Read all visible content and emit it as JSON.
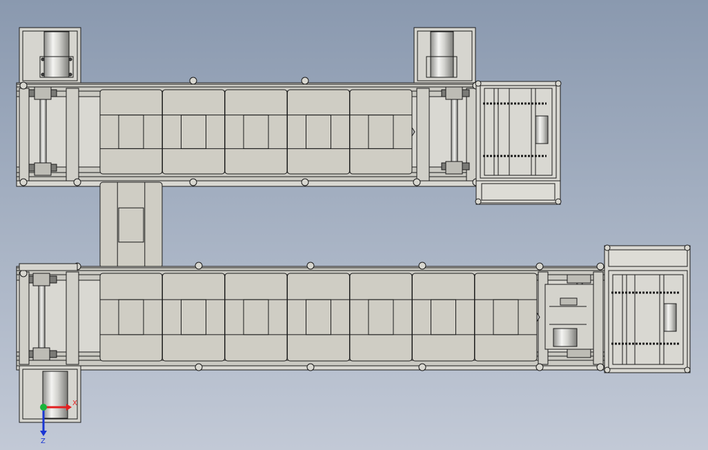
{
  "triad": {
    "x_label": "X",
    "z_label": "Z",
    "colors": {
      "x": "#e32020",
      "y": "#18b43a",
      "z": "#1a36d4"
    }
  },
  "colors": {
    "background_top": "#8a99af",
    "background_bottom": "#c2c9d6",
    "part_fill": "#cfcdc4",
    "frame_fill": "#d9d8d2",
    "edge": "#1a1a1a"
  }
}
